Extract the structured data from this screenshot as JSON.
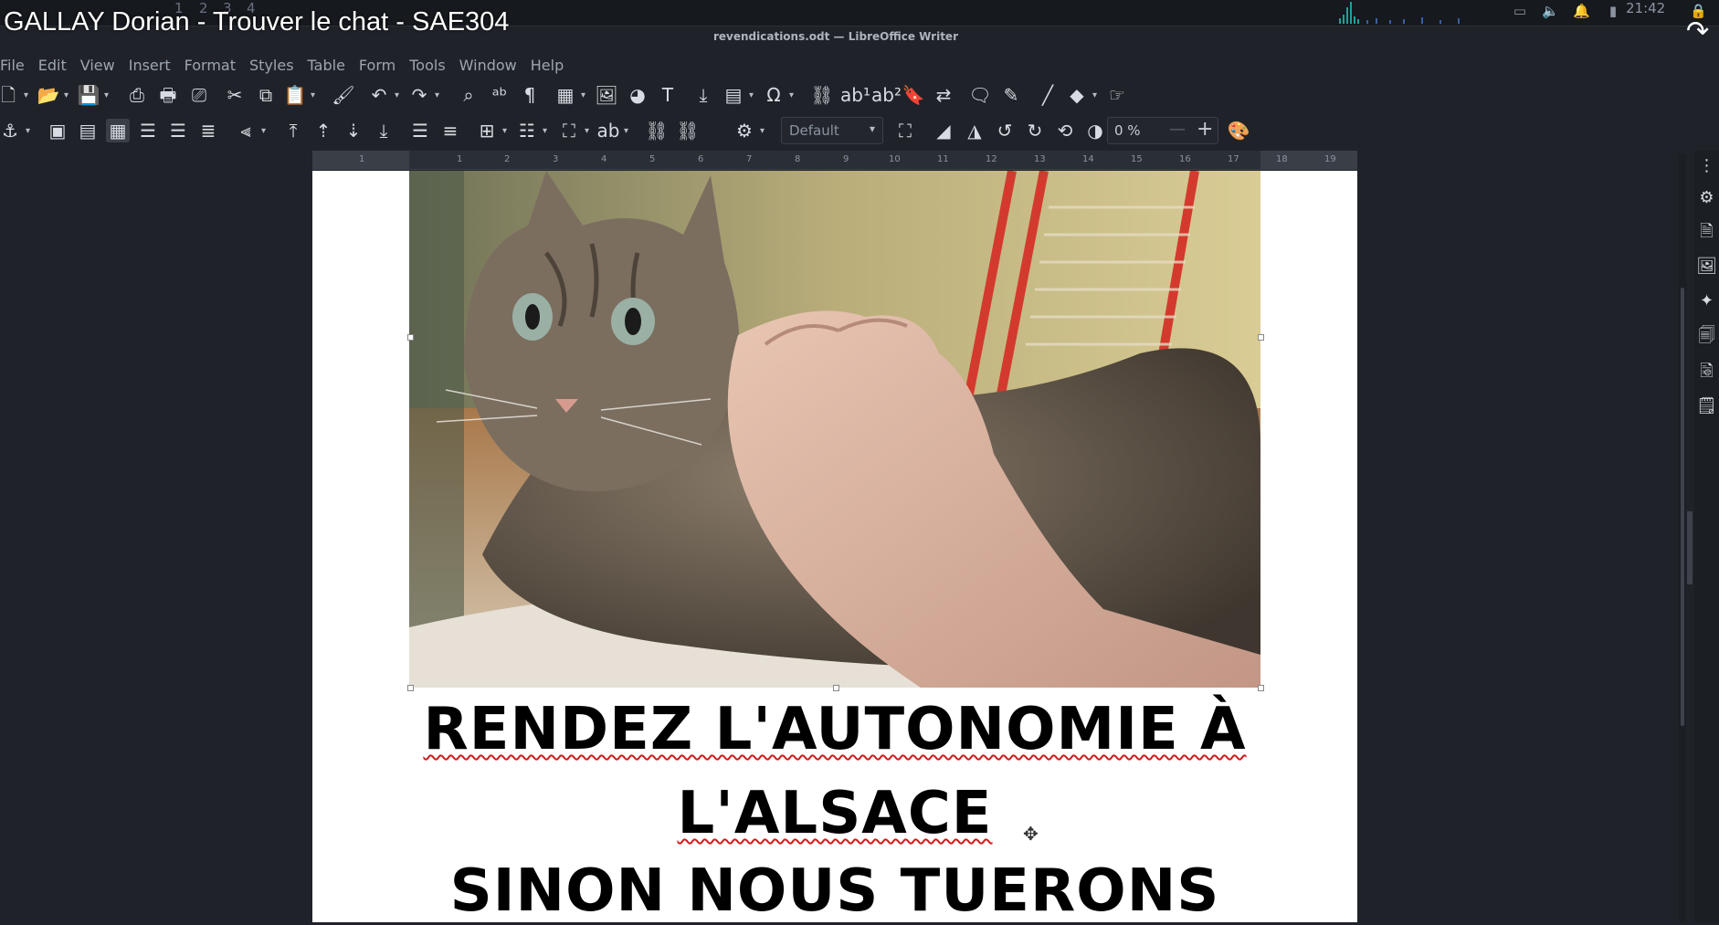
{
  "video_title": "GALLAY Dorian - Trouver le chat - SAE304",
  "taskbar": {
    "workspaces": [
      "1",
      "2",
      "3",
      "4"
    ],
    "clock": "21:42"
  },
  "window_title": "revendications.odt — LibreOffice Writer",
  "menu": [
    "File",
    "Edit",
    "View",
    "Insert",
    "Format",
    "Styles",
    "Table",
    "Form",
    "Tools",
    "Window",
    "Help"
  ],
  "toolbar1": [
    "new",
    "open",
    "save",
    "export-pdf",
    "print",
    "print-preview",
    "cut",
    "copy",
    "paste",
    "clone-formatting",
    "undo",
    "redo",
    "find-replace",
    "spelling",
    "formatting-marks",
    "insert-table",
    "insert-image",
    "insert-chart",
    "insert-text-box",
    "insert-page-break",
    "insert-field",
    "insert-special-character",
    "insert-hyperlink",
    "insert-footnote",
    "insert-endnote",
    "insert-bookmark",
    "insert-cross-reference",
    "insert-comment",
    "track-changes",
    "insert-line",
    "basic-shapes",
    "insert-form-control"
  ],
  "toolbar2": {
    "frame_style": "Default",
    "zoom_value": "0 %"
  },
  "ruler_marks": [
    "1",
    "1",
    "2",
    "3",
    "4",
    "5",
    "6",
    "7",
    "8",
    "9",
    "10",
    "11",
    "12",
    "13",
    "14",
    "15",
    "16",
    "17",
    "18",
    "19"
  ],
  "document": {
    "heading_line1": "RENDEZ L'AUTONOMIE À",
    "heading_line2": "L'ALSACE",
    "heading_line3": "SINON NOUS TUERONS"
  },
  "colors": {
    "background": "#1f2329",
    "page": "#ffffff",
    "spellcheck": "#d21b1b"
  }
}
